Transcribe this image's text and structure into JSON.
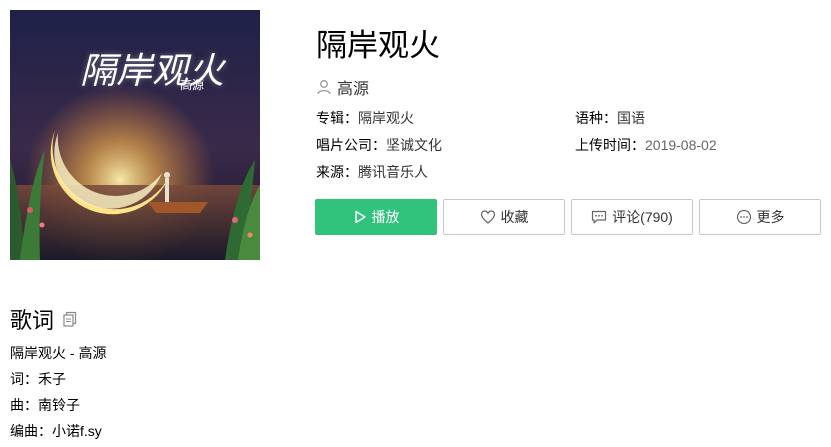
{
  "cover": {
    "title_art": "隔岸观火",
    "artist_art": "高源",
    "colors": {
      "sky": "#1c1d3e",
      "moon": "#ffd86a",
      "water": "#2a2438"
    }
  },
  "song": {
    "title": "隔岸观火",
    "singer": "高源",
    "singer_icon": "user-icon"
  },
  "info": {
    "album_label": "专辑：",
    "album_value": "隔岸观火",
    "language_label": "语种：",
    "language_value": "国语",
    "company_label": "唱片公司：",
    "company_value": "坚诚文化",
    "upload_label": "上传时间：",
    "upload_value": "2019-08-02",
    "source_label": "来源：",
    "source_value": "腾讯音乐人"
  },
  "actions": {
    "play": "播放",
    "favorite": "收藏",
    "comment": "评论(790)",
    "more": "更多",
    "accent": "#31c27c"
  },
  "lyrics": {
    "heading": "歌词",
    "lines": [
      "隔岸观火 - 高源",
      "词：禾子",
      "曲：南铃子",
      "编曲：小诺f.sy"
    ]
  }
}
